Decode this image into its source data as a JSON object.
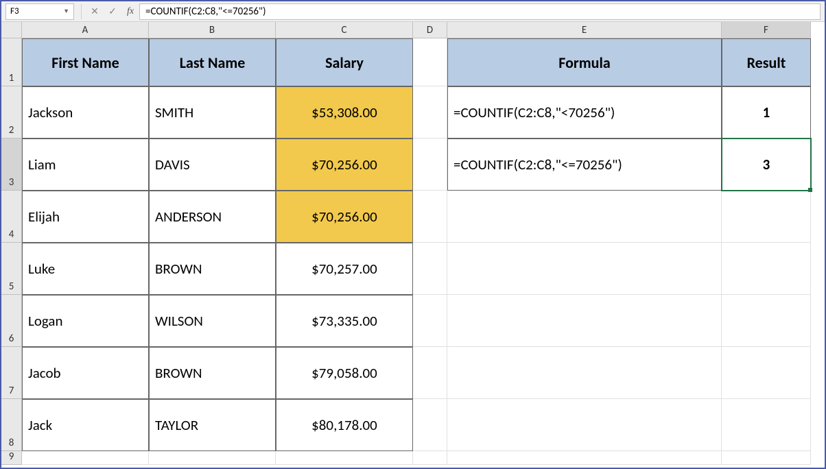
{
  "formula_bar": {
    "name_box": "F3",
    "formula": "=COUNTIF(C2:C8,\"<=70256\")"
  },
  "columns": [
    "A",
    "B",
    "C",
    "D",
    "E",
    "F"
  ],
  "col_widths": {
    "A": 185,
    "B": 185,
    "C": 200,
    "D": 50,
    "E": 400,
    "F": 130
  },
  "row_heights": {
    "hdr": 24,
    "1": 70,
    "others": 76,
    "9": 20
  },
  "table1": {
    "headers": [
      "First Name",
      "Last Name",
      "Salary"
    ],
    "rows": [
      {
        "first": "Jackson",
        "last": "SMITH",
        "salary": "$53,308.00",
        "hl": true
      },
      {
        "first": "Liam",
        "last": "DAVIS",
        "salary": "$70,256.00",
        "hl": true
      },
      {
        "first": "Elijah",
        "last": "ANDERSON",
        "salary": "$70,256.00",
        "hl": true
      },
      {
        "first": "Luke",
        "last": "BROWN",
        "salary": "$70,257.00",
        "hl": false
      },
      {
        "first": "Logan",
        "last": "WILSON",
        "salary": "$73,335.00",
        "hl": false
      },
      {
        "first": "Jacob",
        "last": "BROWN",
        "salary": "$79,058.00",
        "hl": false
      },
      {
        "first": "Jack",
        "last": "TAYLOR",
        "salary": "$80,178.00",
        "hl": false
      }
    ]
  },
  "table2": {
    "headers": [
      "Formula",
      "Result"
    ],
    "rows": [
      {
        "formula": "=COUNTIF(C2:C8,\"<70256\")",
        "result": "1"
      },
      {
        "formula": "=COUNTIF(C2:C8,\"<=70256\")",
        "result": "3"
      }
    ]
  },
  "selected_cell": "F3",
  "selected_col": "F",
  "selected_row": "3"
}
